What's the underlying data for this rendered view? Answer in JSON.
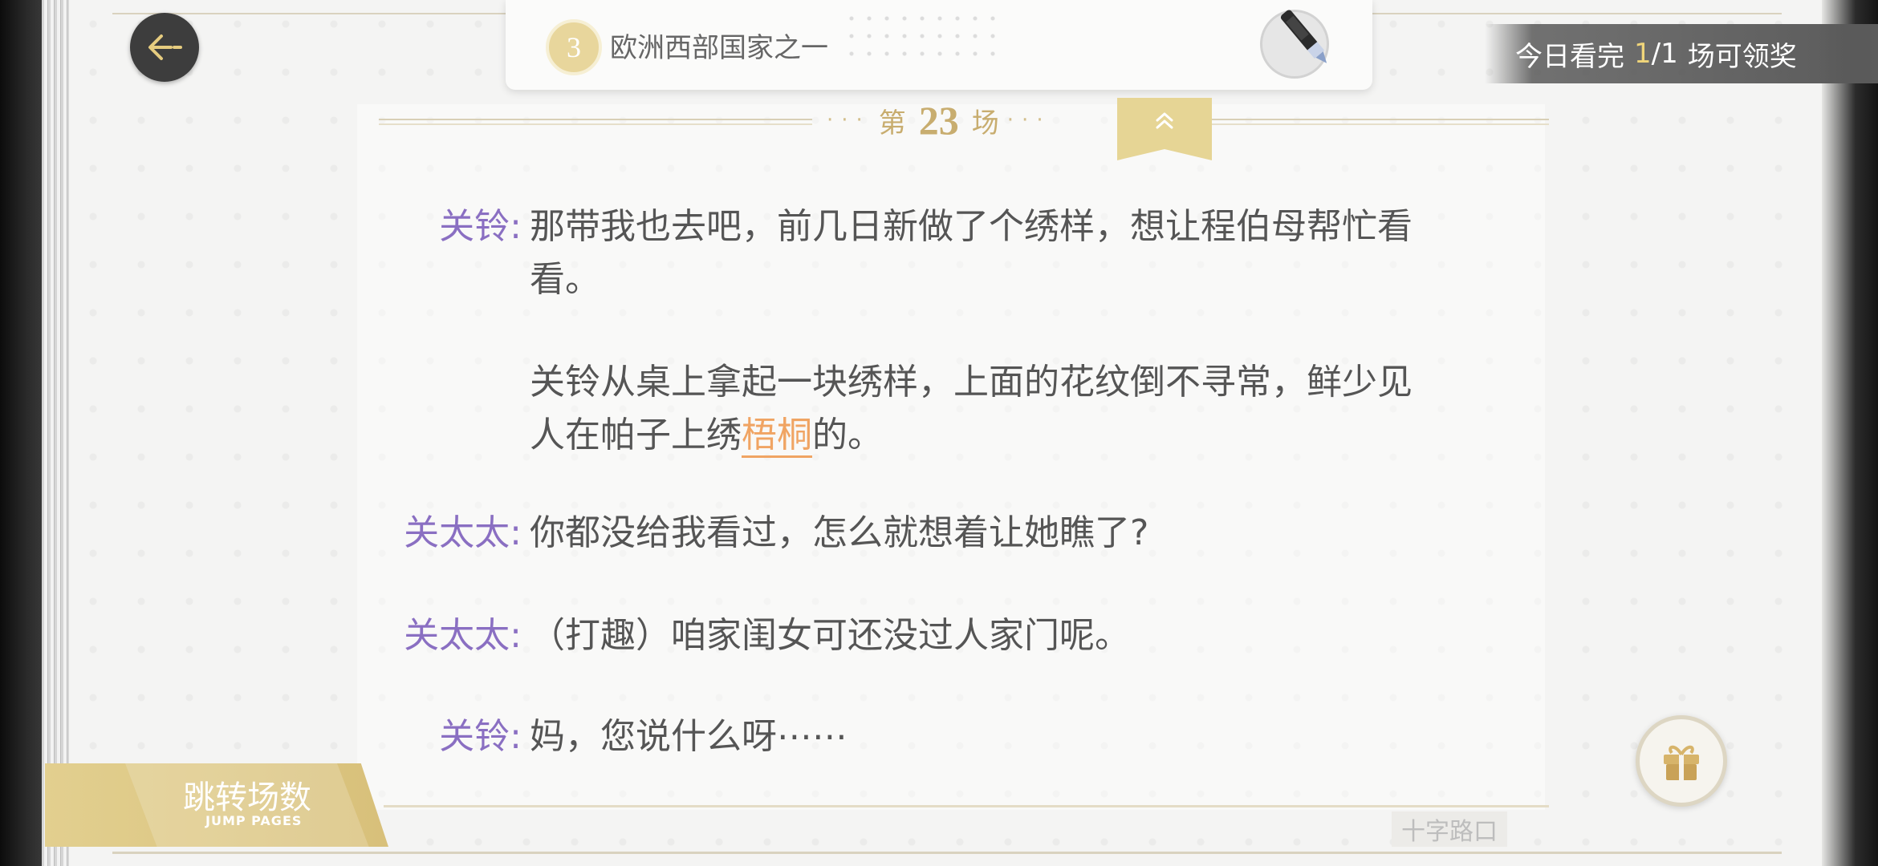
{
  "header": {
    "back_label": "",
    "chapter_number": "3",
    "chapter_title": "欧洲西部国家之一"
  },
  "reward": {
    "prefix": "今日看完",
    "progress_done": "1",
    "progress_total": "/1",
    "suffix": "场可领奖"
  },
  "scene": {
    "prefix": "第",
    "number": "23",
    "suffix": "场"
  },
  "script": [
    {
      "speaker": "关铃:",
      "lines": [
        "那带我也去吧，前几日新做了个绣样，想让程伯母帮忙看",
        "看。"
      ]
    },
    {
      "narration_line1": "关铃从桌上拿起一块绣样，上面的花纹倒不寻常，鲜少见",
      "narration_line2_before": "人在帕子上绣",
      "narration_keyword": "梧桐",
      "narration_line2_after": "的。"
    },
    {
      "speaker": "关太太:",
      "text": "你都没给我看过，怎么就想着让她瞧了?"
    },
    {
      "speaker": "关太太:",
      "text": "（打趣）咱家闺女可还没过人家门呢。"
    },
    {
      "speaker": "关铃:",
      "text": "妈，您说什么呀⋯⋯"
    }
  ],
  "jump": {
    "title": "跳转场数",
    "subtitle": "JUMP PAGES"
  },
  "location": "十字路口",
  "icons": [
    "back-arrow-icon",
    "pen-icon",
    "chevron-up-icon",
    "gift-icon"
  ],
  "colors": {
    "speaker": "#8a6fc2",
    "keyword": "#f0a463",
    "gold": "#e2cf8f"
  }
}
